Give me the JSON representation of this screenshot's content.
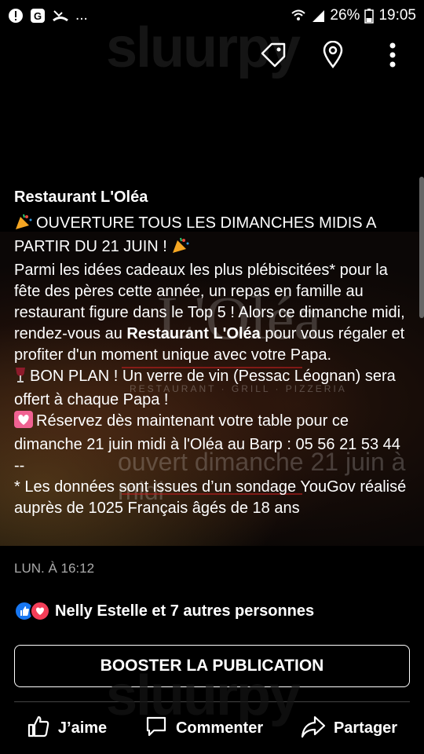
{
  "status": {
    "left_icons": [
      "alert-icon",
      "google-icon",
      "missed-call-icon"
    ],
    "more": "...",
    "battery": "26%",
    "time": "19:05"
  },
  "watermark": {
    "text": "sluurpy"
  },
  "photo": {
    "logo": "L'Oléa",
    "logo_sub": "RESTAURANT · GRILL · PIZZERIA",
    "subtitle": "ouvert dimanche 21 juin à midi"
  },
  "post": {
    "author": "Restaurant L'Oléa",
    "lines": [
      {
        "emoji": "party-popper-icon",
        "text": "OUVERTURE TOUS LES DIMANCHES MIDIS A PARTIR DU 21 JUIN !",
        "emoji_after": "party-popper-icon"
      },
      {
        "text_a": "Parmi les idées cadeaux les plus plébiscitées* pour la fête des pères cette année, un repas en famille au restaurant figure dans le Top 5 ! Alors ce dimanche midi, rendez-vous au ",
        "bold": "Restaurant L'Oléa",
        "text_b": " pour vous régaler et profiter d'un moment unique avec votre Papa."
      },
      {
        "emoji": "wine-glass-icon",
        "text": "BON PLAN ! Un verre de vin (Pessac Léognan) sera offert à chaque Papa !"
      },
      {
        "emoji": "sparkling-heart-icon",
        "text": "Réservez dès maintenant votre table pour ce dimanche 21 juin midi à l'Oléa au Barp : 05 56 21 53 44"
      },
      {
        "text": "--"
      },
      {
        "text": "* Les données sont issues d’un sondage YouGov réalisé auprès de 1025 Français âgés de 18 ans"
      }
    ],
    "timestamp": "LUN. À 16:12",
    "reactions_text": "Nelly Estelle et 7 autres personnes",
    "boost_label": "BOOSTER LA PUBLICATION",
    "actions": {
      "like": "J’aime",
      "comment": "Commenter",
      "share": "Partager"
    }
  },
  "colors": {
    "like_blue": "#1877f2",
    "love_red": "#f33e58",
    "background": "#000000"
  }
}
